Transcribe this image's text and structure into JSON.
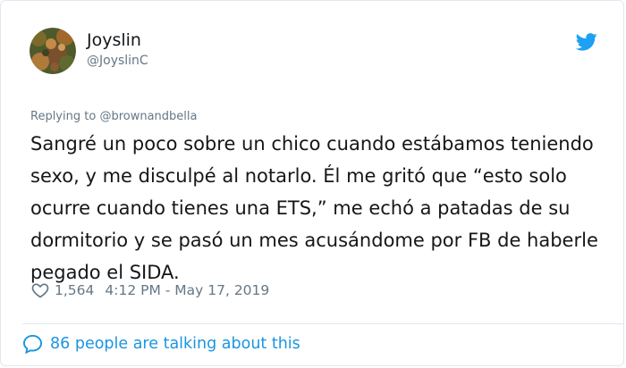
{
  "colors": {
    "text": "#14171a",
    "muted": "#657786",
    "link": "#1b95e0",
    "twitter_blue": "#1da1f2",
    "divider": "#e1e8ed"
  },
  "author": {
    "name": "Joyslin",
    "handle": "@JoyslinC",
    "avatar_icon": "avatar-image"
  },
  "tweet": {
    "reply_prefix": "Replying to",
    "reply_to": "@brownandbella",
    "text": "Sangré un poco sobre un chico cuando estábamos teniendo sexo, y me disculpé al notarlo. Él me gritó que “esto solo ocurre cuando tienes una ETS,” me echó a patadas de su dormitorio y se pasó un mes acusándome por FB de haberle pegado el SIDA.",
    "likes": "1,564",
    "timestamp": "4:12 PM - May 17, 2019"
  },
  "footer": {
    "talking": "86 people are talking about this",
    "icon": "speech-bubble-icon"
  },
  "icons": {
    "brand": "twitter-bird-icon",
    "like": "heart-icon"
  }
}
